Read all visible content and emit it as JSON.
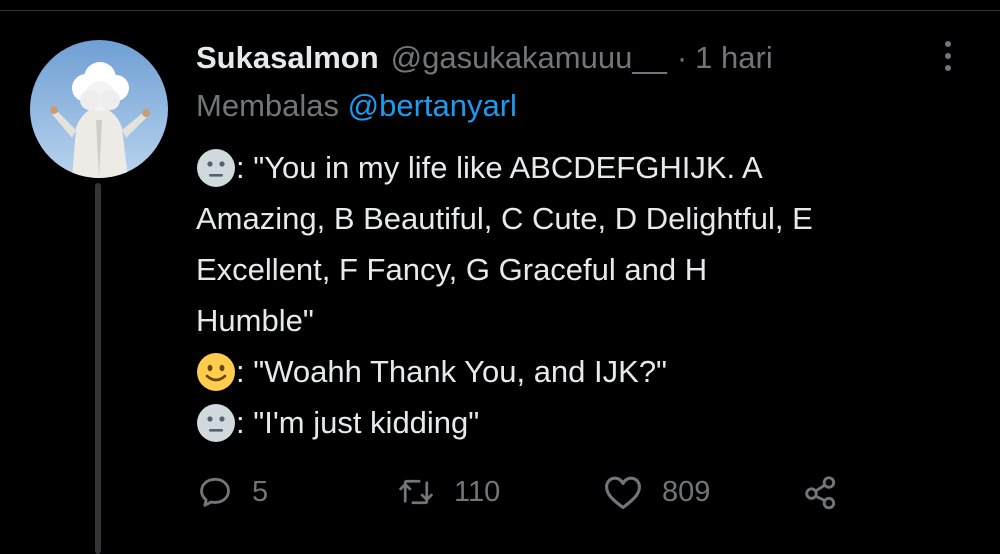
{
  "tweet": {
    "display_name": "Sukasalmon",
    "handle": "@gasukakamuuu__",
    "separator": "·",
    "time": "1 hari",
    "reply_prefix": "Membalas",
    "reply_to": "@bertanyarl",
    "lines": [
      " : \"You in my life like ABCDEFGHIJK. A",
      "Amazing, B Beautiful, C Cute, D Delightful, E",
      "Excellent, F Fancy, G Graceful and H",
      "Humble\"",
      ": \"Woahh Thank You, and IJK?\"",
      " : \"I'm just kidding\""
    ],
    "emoji_icons": [
      "neutral-face-icon",
      "smiling-face-icon",
      "neutral-face-icon"
    ],
    "replies": "5",
    "retweets": "110",
    "likes": "809"
  },
  "colors": {
    "background": "#000000",
    "text": "#e7e9ea",
    "secondary": "#71767b",
    "accent": "#1d9bf0",
    "thread_line": "#333639"
  },
  "icons": [
    "more-options-icon",
    "reply-icon",
    "retweet-icon",
    "like-icon",
    "share-icon"
  ]
}
